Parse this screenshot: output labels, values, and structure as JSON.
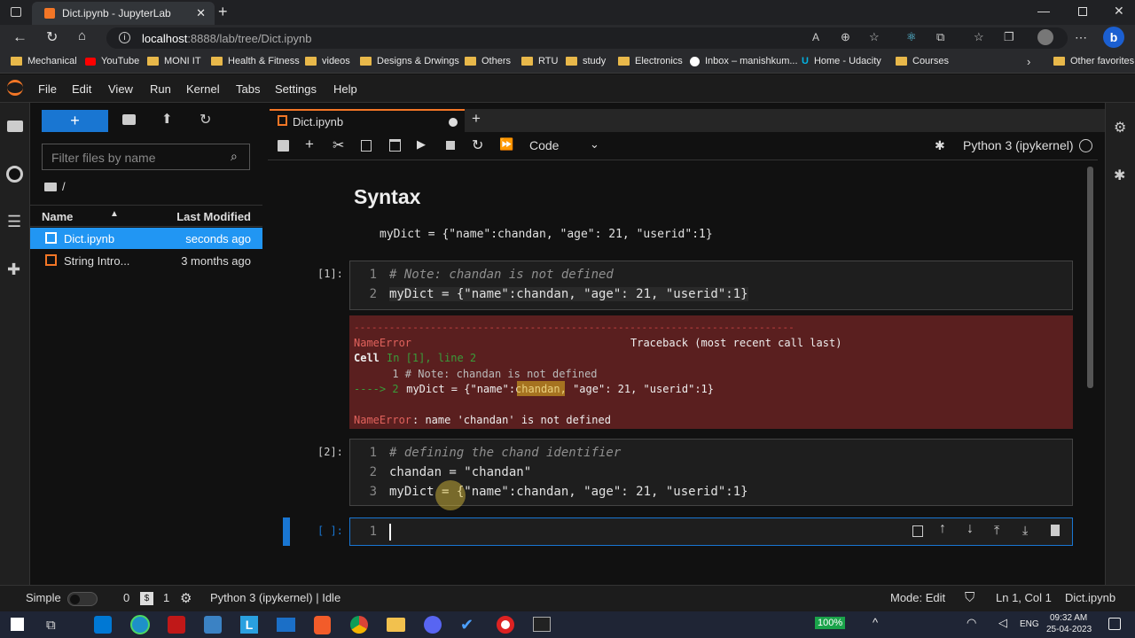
{
  "browser": {
    "tab_title": "Dict.ipynb - JupyterLab",
    "url_host": "localhost",
    "url_rest": ":8888/lab/tree/Dict.ipynb",
    "bookmarks": [
      "Mechanical",
      "YouTube",
      "MONI IT",
      "Health & Fitness",
      "videos",
      "Designs & Drwings",
      "Others",
      "RTU",
      "study",
      "Electronics",
      "Inbox – manishkum...",
      "Home - Udacity",
      "Courses"
    ],
    "other_favorites": "Other favorites"
  },
  "menu": [
    "File",
    "Edit",
    "View",
    "Run",
    "Kernel",
    "Tabs",
    "Settings",
    "Help"
  ],
  "filebrowser": {
    "filter_placeholder": "Filter files by name",
    "path": "/",
    "col_name": "Name",
    "col_modified": "Last Modified",
    "files": [
      {
        "name": "Dict.ipynb",
        "modified": "seconds ago"
      },
      {
        "name": "String Intro...",
        "modified": "3 months ago"
      }
    ]
  },
  "notebook": {
    "tab_label": "Dict.ipynb",
    "cell_type": "Code",
    "kernel": "Python 3 (ipykernel)",
    "heading": "Syntax",
    "syntax_line": "myDict = {\"name\":chandan, \"age\": 21, \"userid\":1}",
    "cells": [
      {
        "prompt": "[1]:",
        "lines": [
          "# Note: chandan is not defined",
          "myDict = {\"name\":chandan, \"age\": 21, \"userid\":1}"
        ]
      },
      {
        "prompt": "[2]:",
        "lines": [
          "# defining the chand identifier",
          "chandan = \"chandan\"",
          "myDict = {\"name\":chandan, \"age\": 21, \"userid\":1}"
        ]
      },
      {
        "prompt": "[ ]:",
        "lines": [
          ""
        ]
      }
    ],
    "error": {
      "dashes": "---------------------------------------------------------------------------",
      "name": "NameError",
      "traceback_title": "Traceback (most recent call last)",
      "cell_word": "Cell",
      "cell_loc": "In [1], line 2",
      "line1": "      1 # Note: chandan is not defined",
      "arrow": "----> 2",
      "line2_code": " myDict = {\"name\":chandan, \"age\": 21, \"userid\":1}",
      "final_msg": ": name 'chandan' is not defined"
    }
  },
  "statusbar": {
    "simple": "Simple",
    "count1": "0",
    "count2": "1",
    "kernel_status": "Python 3 (ipykernel) | Idle",
    "mode": "Mode: Edit",
    "position": "Ln 1, Col 1",
    "file": "Dict.ipynb"
  },
  "taskbar": {
    "battery": "100%",
    "lang": "ENG",
    "time": "09:32 AM",
    "date": "25-04-2023"
  }
}
